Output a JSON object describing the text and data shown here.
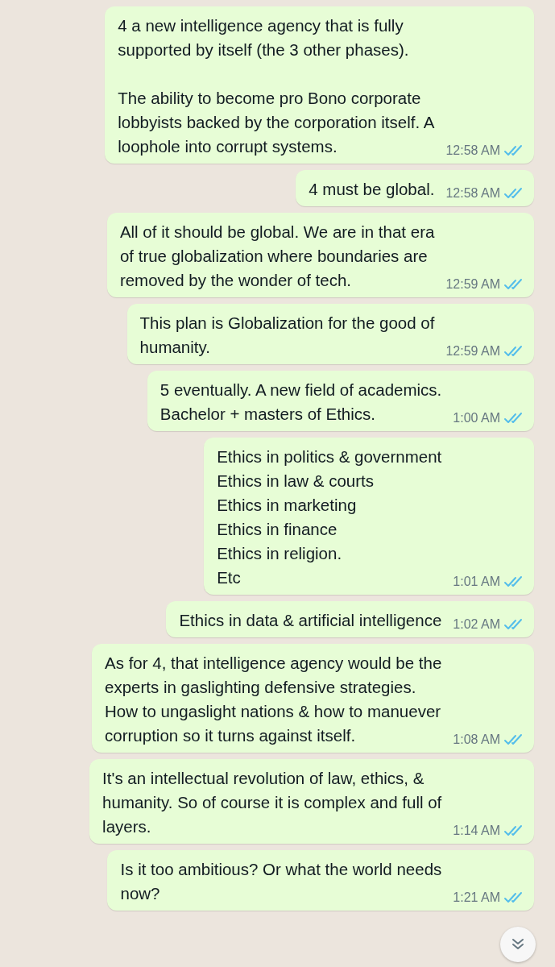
{
  "messages": [
    {
      "text": "4 a new intelligence agency that is fully\nsupported by itself (the 3 other phases).\n\nThe ability to become pro Bono corporate\nlobbyists backed by the corporation itself. A\nloophole into corrupt systems.",
      "time": "12:58 AM",
      "read": true
    },
    {
      "text": "4 must be global.",
      "time": "12:58 AM",
      "read": true
    },
    {
      "text": "All of it should be global. We are in that era\nof true globalization where boundaries are\nremoved by the wonder of tech.",
      "time": "12:59 AM",
      "read": true
    },
    {
      "text": "This plan is Globalization for the good of\nhumanity.",
      "time": "12:59 AM",
      "read": true
    },
    {
      "text": "5 eventually. A new field of academics.\nBachelor + masters of Ethics.\n",
      "time": "1:00 AM",
      "read": true
    },
    {
      "text": "Ethics in politics & government\nEthics in law & courts\nEthics in marketing\nEthics in finance\nEthics in religion.\nEtc",
      "time": "1:01 AM",
      "read": true
    },
    {
      "text": "Ethics in data & artificial intelligence",
      "time": "1:02 AM",
      "read": true
    },
    {
      "text": "As for 4, that intelligence agency would be the\nexperts in gaslighting defensive strategies.\nHow to ungaslight nations & how to manuever\ncorruption so it turns against itself.",
      "time": "1:08 AM",
      "read": true
    },
    {
      "text": "It's an intellectual revolution of law, ethics, &\nhumanity. So of course it is complex and full of\nlayers.",
      "time": "1:14 AM",
      "read": true
    },
    {
      "text": "Is it too ambitious? Or what the world needs\nnow?",
      "time": "1:21 AM",
      "read": true
    }
  ]
}
